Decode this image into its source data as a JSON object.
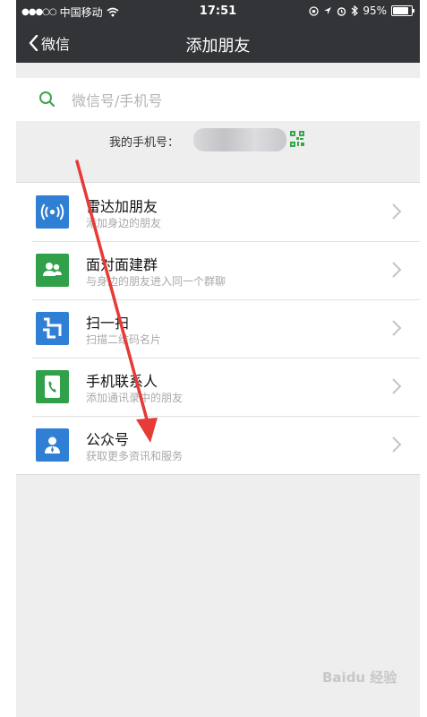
{
  "status_bar": {
    "carrier": "中国移动",
    "time": "17:51",
    "battery": "95%",
    "battery_level": 0.95
  },
  "nav": {
    "back_label": "微信",
    "title": "添加朋友"
  },
  "search": {
    "placeholder": "微信号/手机号"
  },
  "my_phone": {
    "label": "我的手机号："
  },
  "options": [
    {
      "title": "雷达加朋友",
      "subtitle": "添加身边的朋友",
      "icon": "radar-icon",
      "color": "#2f7fd4"
    },
    {
      "title": "面对面建群",
      "subtitle": "与身边的朋友进入同一个群聊",
      "icon": "group-icon",
      "color": "#31a04a"
    },
    {
      "title": "扫一扫",
      "subtitle": "扫描二维码名片",
      "icon": "scan-icon",
      "color": "#2f7fd4"
    },
    {
      "title": "手机联系人",
      "subtitle": "添加通讯录中的朋友",
      "icon": "phone-contacts-icon",
      "color": "#31a04a"
    },
    {
      "title": "公众号",
      "subtitle": "获取更多资讯和服务",
      "icon": "official-account-icon",
      "color": "#2f7fd4"
    }
  ],
  "watermark": {
    "text": "Baidu 经验"
  },
  "colors": {
    "nav_bg": "#333437",
    "accent_green": "#31a04a",
    "accent_blue": "#2f7fd4",
    "annotation_red": "#e63b36"
  }
}
